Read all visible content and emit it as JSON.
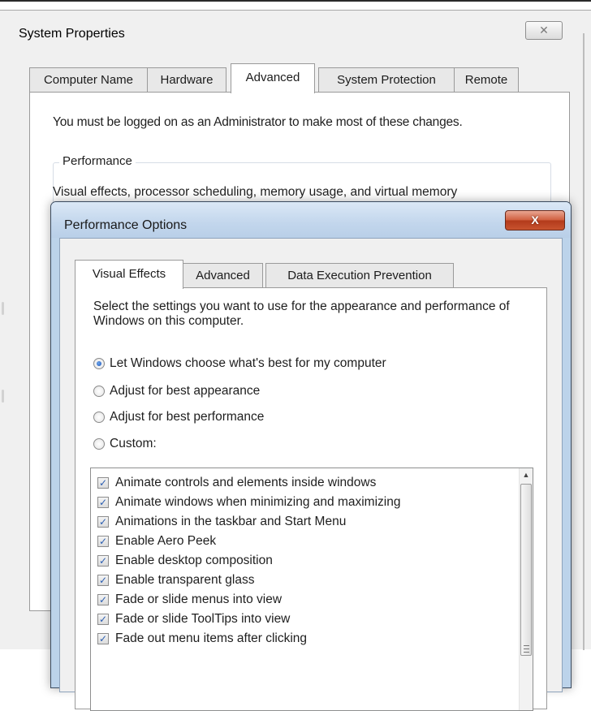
{
  "system_properties": {
    "title": "System Properties",
    "close_glyph": "✕",
    "tabs": [
      "Computer Name",
      "Hardware",
      "Advanced",
      "System Protection",
      "Remote"
    ],
    "active_tab": "Advanced",
    "admin_notice": "You must be logged on as an Administrator to make most of these changes.",
    "performance_group_label": "Performance",
    "performance_description": "Visual effects, processor scheduling, memory usage, and virtual memory"
  },
  "performance_options": {
    "title": "Performance Options",
    "close_glyph": "X",
    "tabs": [
      "Visual Effects",
      "Advanced",
      "Data Execution Prevention"
    ],
    "active_tab": "Visual Effects",
    "description": "Select the settings you want to use for the appearance and performance of Windows on this computer.",
    "radio_options": [
      {
        "label": "Let Windows choose what's best for my computer",
        "selected": true
      },
      {
        "label": "Adjust for best appearance",
        "selected": false
      },
      {
        "label": "Adjust for best performance",
        "selected": false
      },
      {
        "label": "Custom:",
        "selected": false
      }
    ],
    "effects": [
      {
        "label": "Animate controls and elements inside windows",
        "checked": true
      },
      {
        "label": "Animate windows when minimizing and maximizing",
        "checked": true
      },
      {
        "label": "Animations in the taskbar and Start Menu",
        "checked": true
      },
      {
        "label": "Enable Aero Peek",
        "checked": true
      },
      {
        "label": "Enable desktop composition",
        "checked": true
      },
      {
        "label": "Enable transparent glass",
        "checked": true
      },
      {
        "label": "Fade or slide menus into view",
        "checked": true
      },
      {
        "label": "Fade or slide ToolTips into view",
        "checked": true
      },
      {
        "label": "Fade out menu items after clicking",
        "checked": true
      }
    ],
    "check_glyph": "✓",
    "scroll_up_glyph": "▲"
  }
}
